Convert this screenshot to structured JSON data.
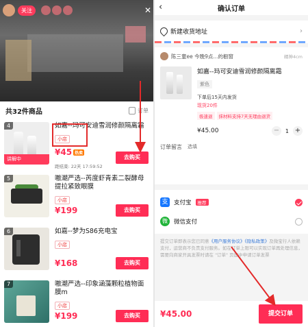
{
  "left": {
    "live": {
      "follow_label": "关注",
      "close": "✕"
    },
    "sheet": {
      "title": "共32件商品",
      "order_label": "订单"
    },
    "items": [
      {
        "index": "4",
        "title": "如嘉--玛可安迪雪润修颜隔离霜",
        "tag": "小店",
        "price": "¥45",
        "hot": "热卖",
        "explain": "讲解中",
        "countdown": "距结束: 22天 17:59:52",
        "buy": "去购买"
      },
      {
        "index": "5",
        "title": "嗷潮严选--芮度虾青素二裂酵母提拉紧致眼膜",
        "tag": "小店",
        "price": "¥199",
        "buy": "去购买"
      },
      {
        "index": "6",
        "title": "如嘉--梦为S86充电宝",
        "tag": "小店",
        "price": "¥168",
        "buy": "去购买"
      },
      {
        "index": "7",
        "title": "嗷潮严选--印象涵藻颗粒植物面膜m",
        "tag": "小店",
        "price": "¥199",
        "buy": "去购买"
      }
    ]
  },
  "right": {
    "back": "‹",
    "title": "确认订单",
    "address": {
      "label": "新建收货地址",
      "chevron": "›"
    },
    "shop": {
      "name": "陈三童ee 今晚9点...的橱窗",
      "badge": "精神4cm"
    },
    "product": {
      "name": "如嘉--玛可安迪雪润修颜隔离霜",
      "variant": "紫色",
      "ship": "下单后15天内发货",
      "warn": "现货20件",
      "tags": [
        "极速退",
        "抹材料支持7天无理由退货"
      ],
      "price": "¥45.00",
      "qty": "1",
      "minus": "−",
      "plus": "+"
    },
    "note": {
      "label": "订单留言",
      "placeholder": "选填"
    },
    "pay": {
      "alipay_icon": "支",
      "alipay": "支付宝",
      "recommend": "推荐",
      "wechat_icon": "微",
      "wechat": "微信支付"
    },
    "agreement": {
      "prefix": "提交订单即表示您已同意",
      "link1": "《用户服务协议》",
      "link2": "《隐私政策》",
      "suffix": "及微宝行人依赖支付，运营商不负责支付服务。如在订单上限可以实现订单再处理信息，需要向商家开具发票时请在 \"订单\" 页面中申请订单发票"
    },
    "total": "¥45.00",
    "submit": "提交订单"
  }
}
